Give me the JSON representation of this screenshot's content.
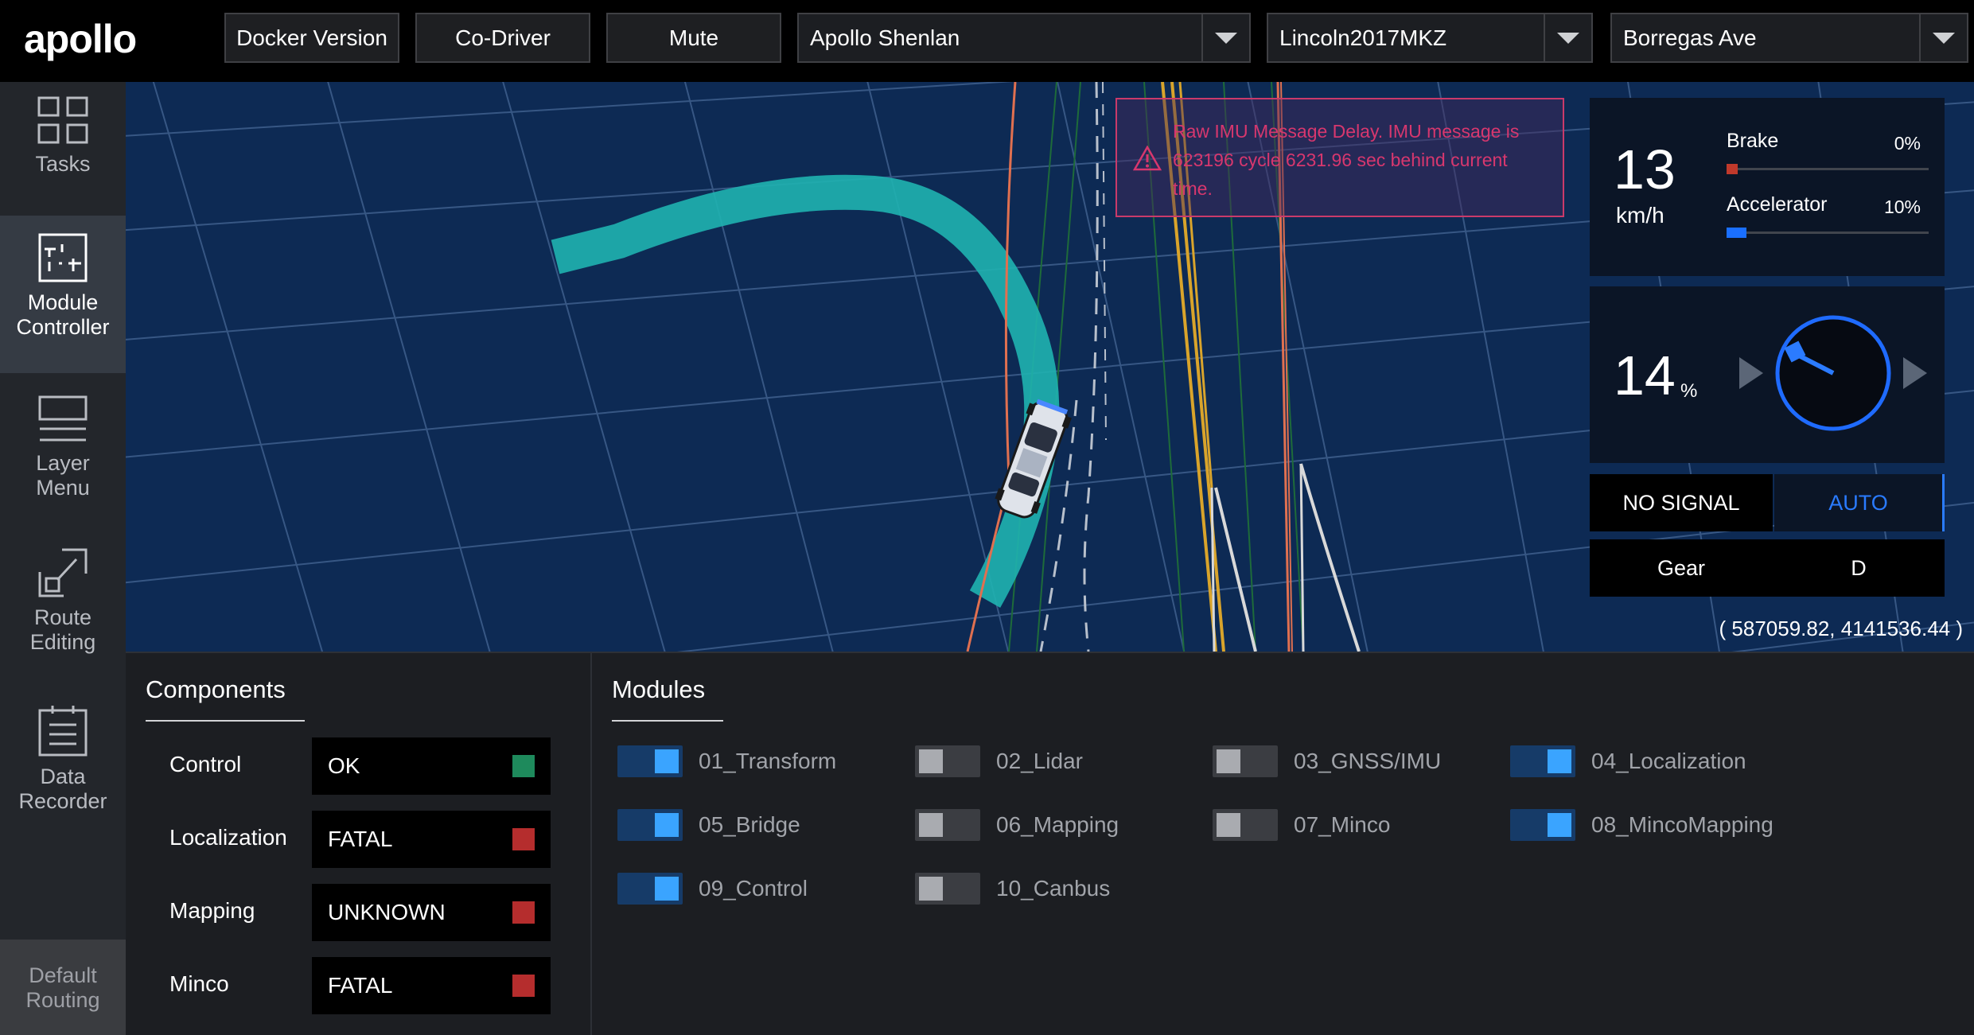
{
  "header": {
    "logo_text": "apollo",
    "buttons": [
      {
        "label": "Docker Version"
      },
      {
        "label": "Co-Driver"
      },
      {
        "label": "Mute"
      }
    ],
    "selects": [
      {
        "value": "Apollo Shenlan"
      },
      {
        "value": "Lincoln2017MKZ"
      },
      {
        "value": "Borregas Ave"
      }
    ]
  },
  "sidebar": {
    "items": [
      {
        "label_1": "Tasks",
        "label_2": "",
        "icon": "tasks-icon",
        "active": false
      },
      {
        "label_1": "Module",
        "label_2": "Controller",
        "icon": "module-controller-icon",
        "active": true
      },
      {
        "label_1": "Layer",
        "label_2": "Menu",
        "icon": "layer-menu-icon",
        "active": false
      },
      {
        "label_1": "Route",
        "label_2": "Editing",
        "icon": "route-editing-icon",
        "active": false
      },
      {
        "label_1": "Data",
        "label_2": "Recorder",
        "icon": "data-recorder-icon",
        "active": false
      }
    ],
    "bottom": {
      "label_1": "Default",
      "label_2": "Routing"
    }
  },
  "alert": {
    "message": "Raw IMU Message Delay. IMU message is 623196 cycle 6231.96 sec behind current time.",
    "color": "#d7376e"
  },
  "dashboard": {
    "speed": "13",
    "speed_unit": "km/h",
    "brake_label": "Brake",
    "brake_value": "0%",
    "brake_fraction": 0.0,
    "accel_label": "Accelerator",
    "accel_value": "10%",
    "accel_fraction": 0.1,
    "steering": "14",
    "steering_unit": "%",
    "signal": "NO SIGNAL",
    "mode": "AUTO",
    "gear_label": "Gear",
    "gear_value": "D",
    "coordinates": "( 587059.82, 4141536.44 )"
  },
  "components": {
    "title": "Components",
    "items": [
      {
        "name": "Control",
        "status": "OK",
        "color": "#1e8a5c"
      },
      {
        "name": "Localization",
        "status": "FATAL",
        "color": "#b52d2d"
      },
      {
        "name": "Mapping",
        "status": "UNKNOWN",
        "color": "#b52d2d"
      },
      {
        "name": "Minco",
        "status": "FATAL",
        "color": "#b52d2d"
      }
    ]
  },
  "modules": {
    "title": "Modules",
    "items": [
      {
        "label": "01_Transform",
        "on": true
      },
      {
        "label": "02_Lidar",
        "on": false
      },
      {
        "label": "03_GNSS/IMU",
        "on": false
      },
      {
        "label": "04_Localization",
        "on": true
      },
      {
        "label": "05_Bridge",
        "on": true
      },
      {
        "label": "06_Mapping",
        "on": false
      },
      {
        "label": "07_Minco",
        "on": false
      },
      {
        "label": "08_MincoMapping",
        "on": true
      },
      {
        "label": "09_Control",
        "on": true
      },
      {
        "label": "10_Canbus",
        "on": false
      }
    ]
  },
  "colors": {
    "accent": "#3aa4ff",
    "map_bg": "#0d2a54",
    "planning_path": "#1fb3b0",
    "lane_orange": "#e07050",
    "lane_yellow": "#d9a42b"
  }
}
